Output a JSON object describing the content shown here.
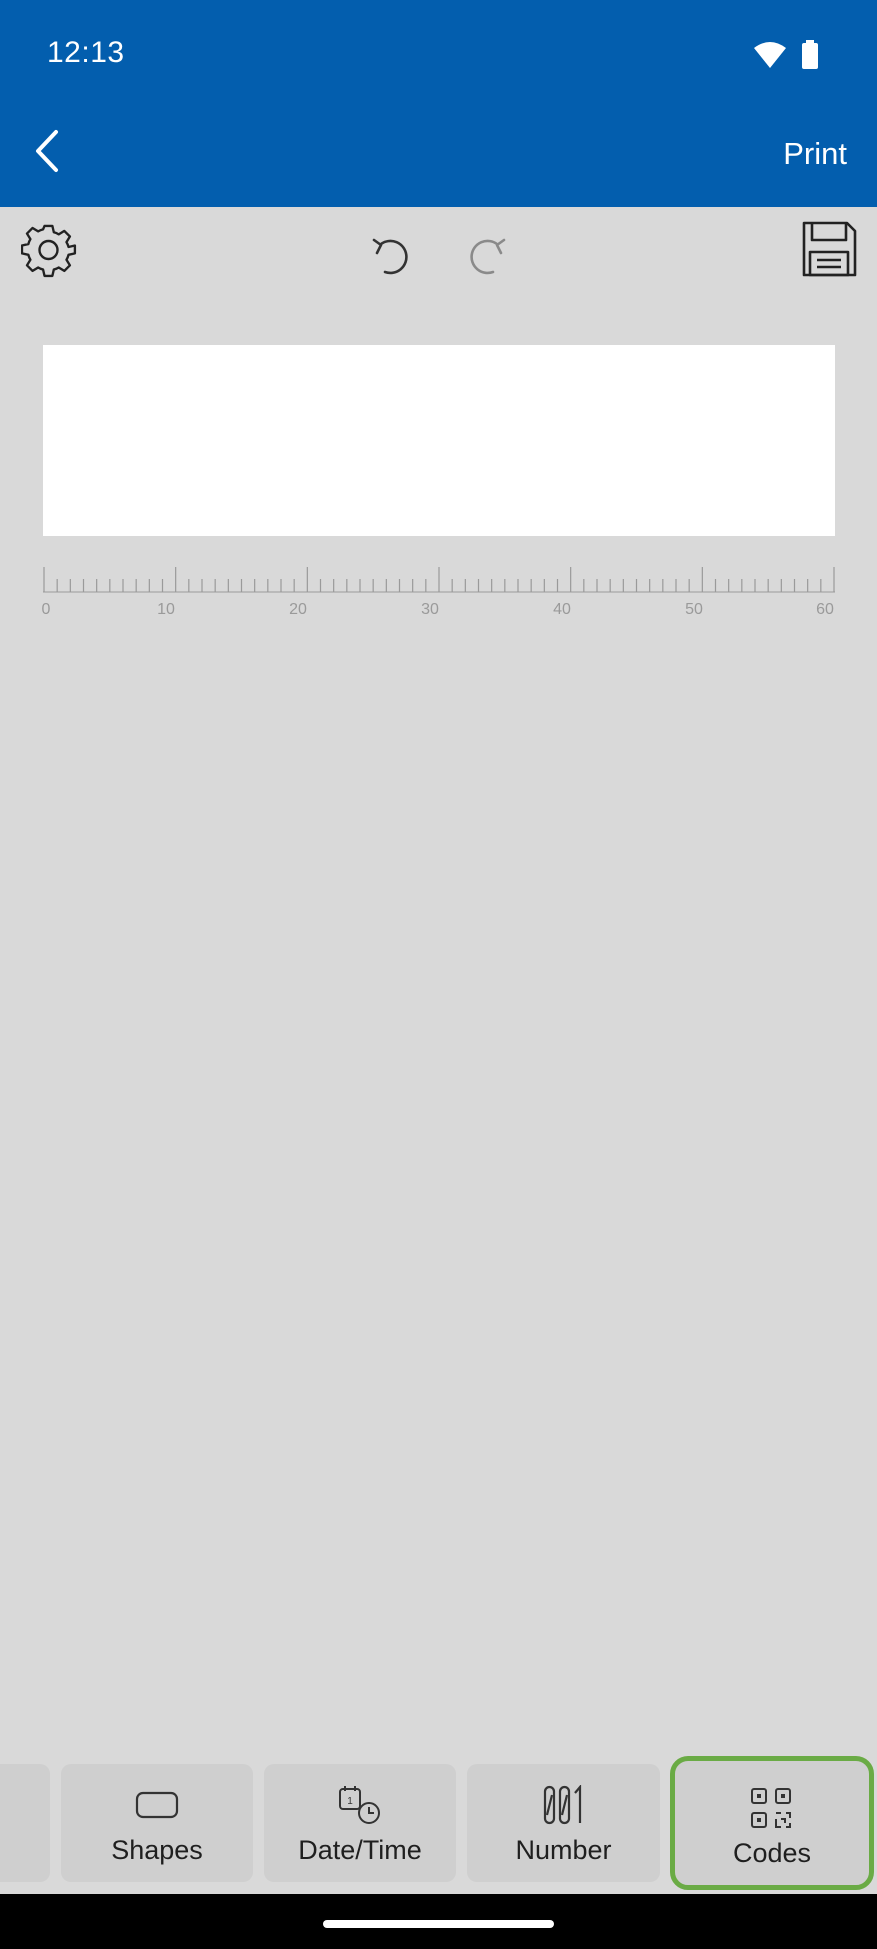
{
  "status_bar": {
    "time": "12:13",
    "icons": [
      "wifi-icon",
      "battery-icon"
    ]
  },
  "app_bar": {
    "back_icon": "back-arrow-icon",
    "print_label": "Print",
    "background_color": "#035eae"
  },
  "toolbar": {
    "settings_icon": "gear-icon",
    "undo_icon": "undo-icon",
    "redo_icon": "redo-icon",
    "save_icon": "floppy-disk-icon"
  },
  "ruler": {
    "labels": [
      "0",
      "10",
      "20",
      "30",
      "40",
      "50",
      "60"
    ]
  },
  "bottom_tabs": [
    {
      "label": "Shapes",
      "icon": "rounded-rectangle-icon"
    },
    {
      "label": "Date/Time",
      "icon": "calendar-clock-icon"
    },
    {
      "label": "Number",
      "icon": "number-icon"
    },
    {
      "label": "Codes",
      "icon": "qr-code-icon",
      "selected": true
    }
  ],
  "accent_color": "#6aab45"
}
